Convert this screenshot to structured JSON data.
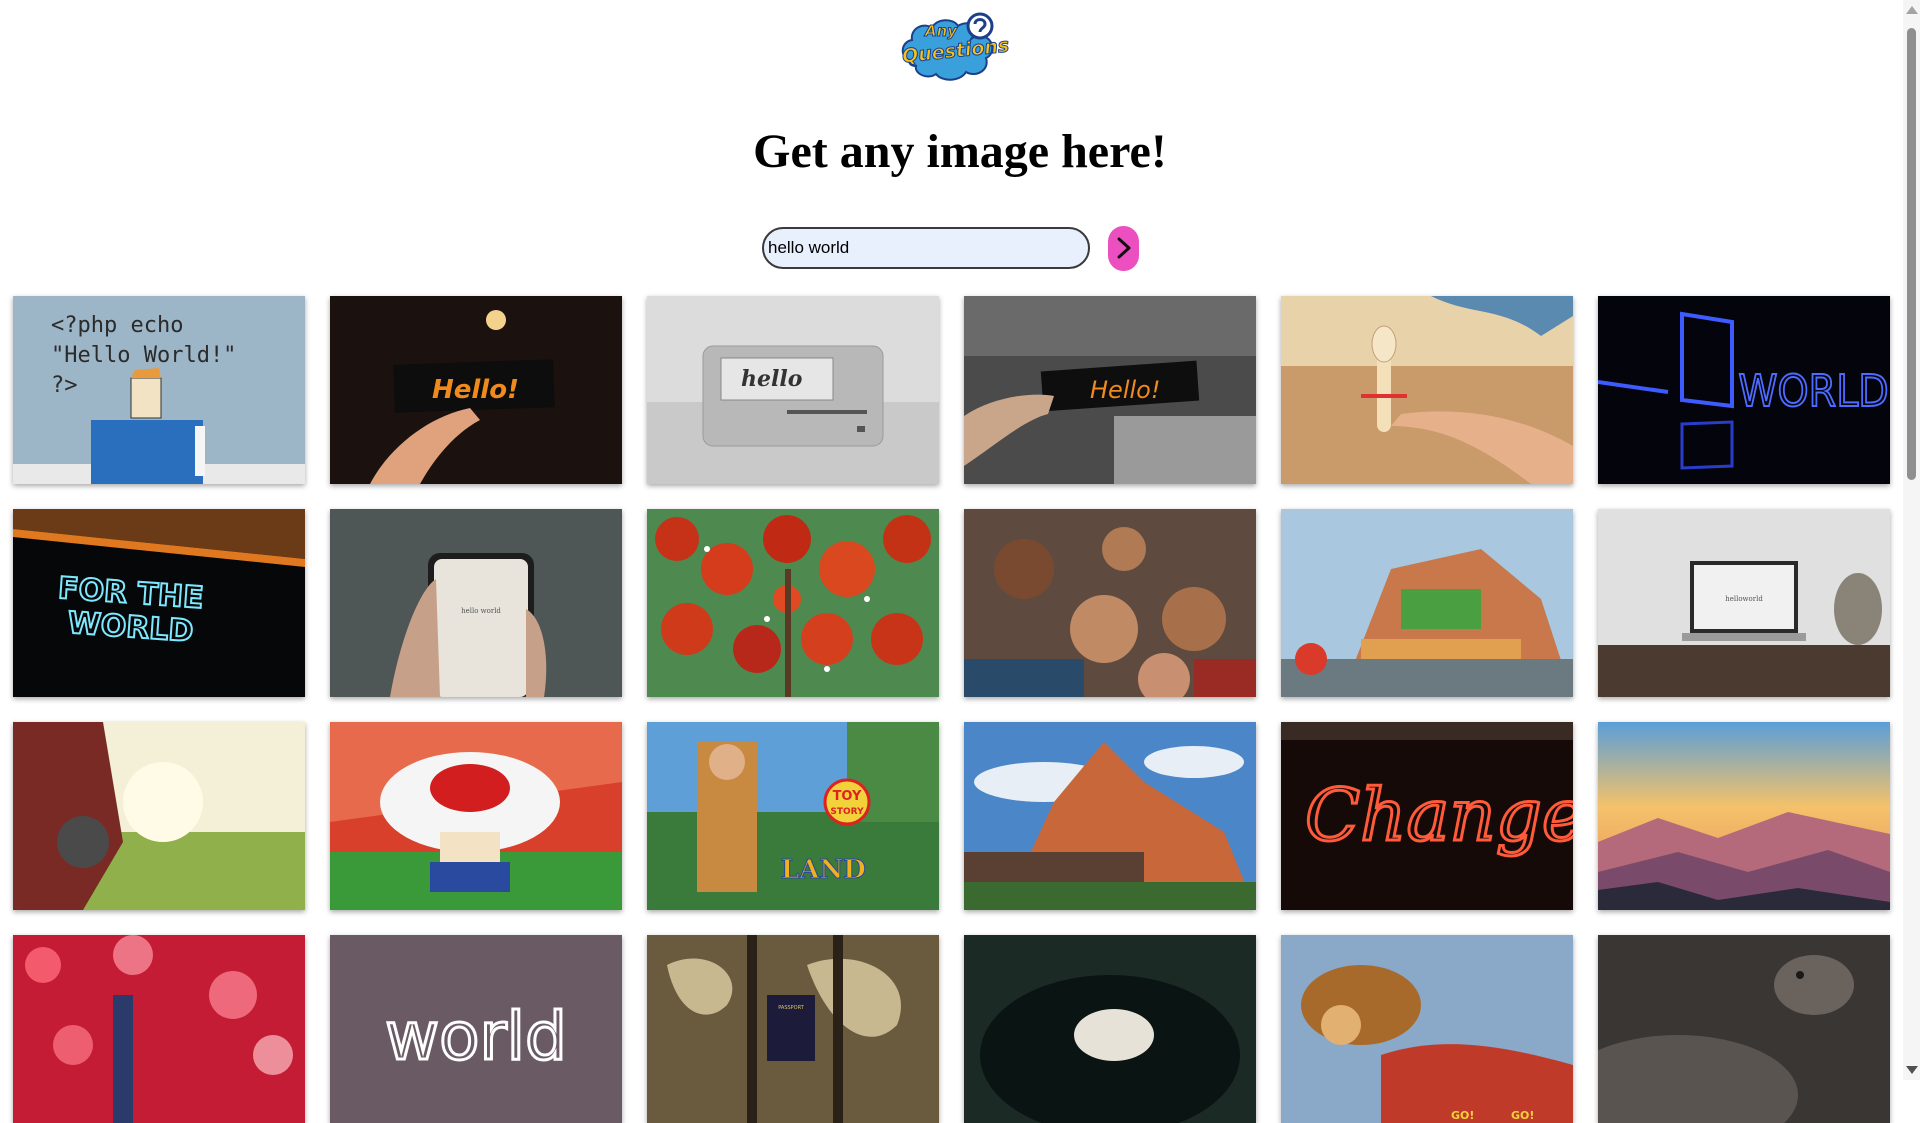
{
  "logo": {
    "line1": "Any",
    "line2": "Questions"
  },
  "heading": "Get any image here!",
  "search": {
    "value": "hello world",
    "placeholder": ""
  },
  "results": [
    {
      "text_line1": "<?php echo",
      "text_line2": "\"Hello World!\"",
      "text_line3": "?>"
    },
    {
      "text": "Hello!"
    },
    {
      "text": "hello"
    },
    {
      "text": "Hello!"
    },
    {},
    {
      "text": "WORLD"
    },
    {
      "text_line1": "FOR THE",
      "text_line2": "WORLD"
    },
    {
      "text": "hello world"
    },
    {},
    {},
    {},
    {
      "text": "helloworld"
    },
    {},
    {},
    {
      "text_line1": "TOY",
      "text_line2": "STORY",
      "text_line3": "LAND"
    },
    {},
    {
      "text": "Change"
    },
    {},
    {},
    {
      "text": "world"
    },
    {
      "text": "PASSPORT"
    },
    {},
    {
      "text_line1": "GO!",
      "text_line2": "GO!"
    },
    {}
  ]
}
